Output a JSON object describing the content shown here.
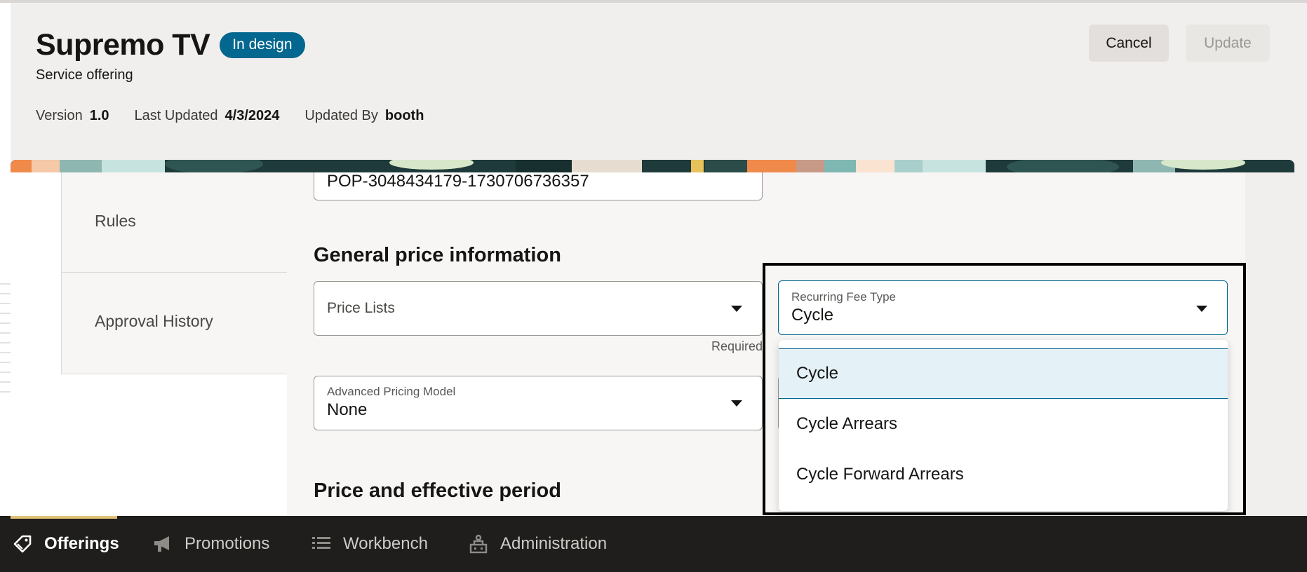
{
  "header": {
    "title": "Supremo TV",
    "status_badge": "In design",
    "subtitle": "Service offering",
    "meta": {
      "version_label": "Version",
      "version_value": "1.0",
      "last_updated_label": "Last Updated",
      "last_updated_value": "4/3/2024",
      "updated_by_label": "Updated By",
      "updated_by_value": "booth"
    },
    "cancel_label": "Cancel",
    "update_label": "Update"
  },
  "side_nav": {
    "items": [
      {
        "label": "Rules"
      },
      {
        "label": "Approval History"
      }
    ]
  },
  "form": {
    "previous_field_value": "POP-3048434179-1730706736357",
    "general_section_title": "General price information",
    "price_lists": {
      "placeholder": "Price Lists",
      "helper": "Required"
    },
    "advanced_pricing_model": {
      "label": "Advanced Pricing Model",
      "value": "None"
    },
    "recurring_fee_type": {
      "label": "Recurring Fee Type",
      "value": "Cycle",
      "options": [
        "Cycle",
        "Cycle Arrears",
        "Cycle Forward Arrears"
      ],
      "selected_index": 0
    },
    "price_section_title": "Price and effective period"
  },
  "bottom_nav": {
    "tabs": [
      {
        "label": "Offerings",
        "icon": "tag-icon",
        "active": true
      },
      {
        "label": "Promotions",
        "icon": "megaphone-icon",
        "active": false
      },
      {
        "label": "Workbench",
        "icon": "list-icon",
        "active": false
      },
      {
        "label": "Administration",
        "icon": "admin-icon",
        "active": false
      }
    ]
  },
  "colors": {
    "accent": "#04678f",
    "selected_option_bg": "#e4f1f7",
    "bottom_bar": "#1f1e1c",
    "active_tab_indicator": "#e0c375"
  }
}
